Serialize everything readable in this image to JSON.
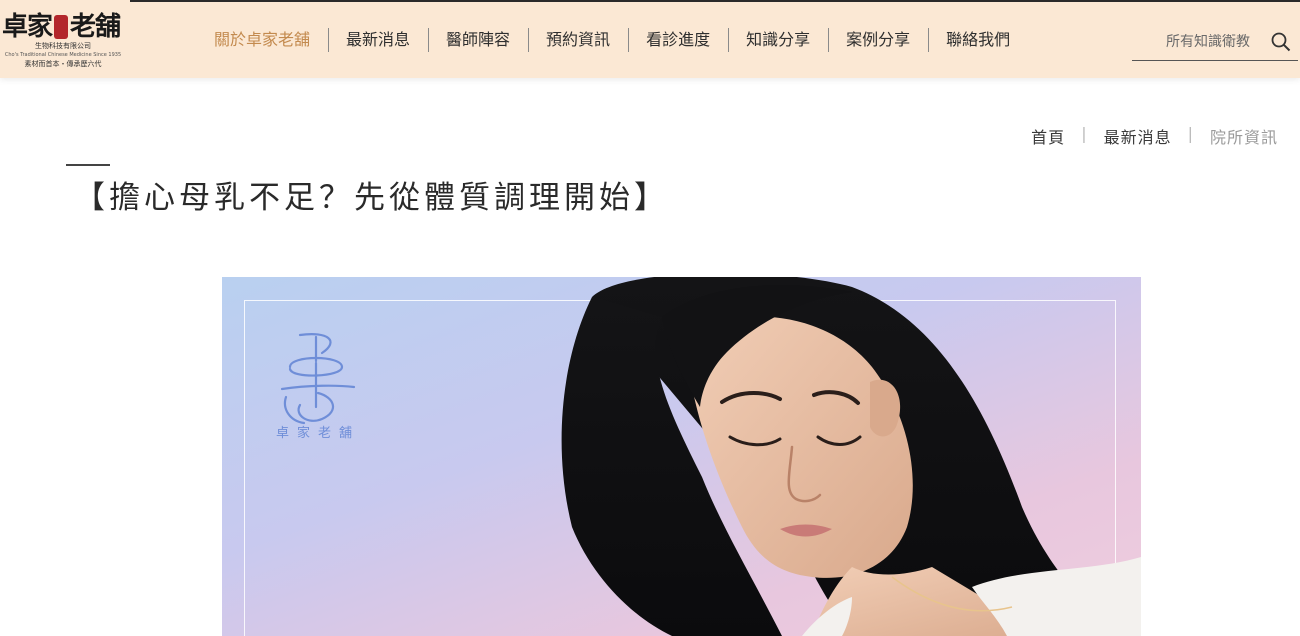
{
  "logo": {
    "main_left": "卓家",
    "main_right": "老舖",
    "company": "生物科技有限公司",
    "english": "Cho's Traditional Chinese Medicine Since 1935",
    "slogan": "素材而首本・傳承歷六代"
  },
  "nav": {
    "items": [
      {
        "label": "關於卓家老舖",
        "active": true
      },
      {
        "label": "最新消息"
      },
      {
        "label": "醫師陣容"
      },
      {
        "label": "預約資訊"
      },
      {
        "label": "看診進度"
      },
      {
        "label": "知識分享"
      },
      {
        "label": "案例分享"
      },
      {
        "label": "聯絡我們"
      }
    ]
  },
  "search": {
    "placeholder": "所有知識衛教",
    "icon": "search-icon"
  },
  "breadcrumb": {
    "home": "首頁",
    "news": "最新消息",
    "current": "院所資訊"
  },
  "article": {
    "title": "【擔心母乳不足？先從體質調理開始】"
  },
  "hero": {
    "watermark_text": "卓家老舖"
  },
  "colors": {
    "header_bg": "#fbe8d4",
    "active_nav": "#c38a4e",
    "brand_seal": "#b3262b",
    "hero_logo": "#6f8ed8"
  }
}
